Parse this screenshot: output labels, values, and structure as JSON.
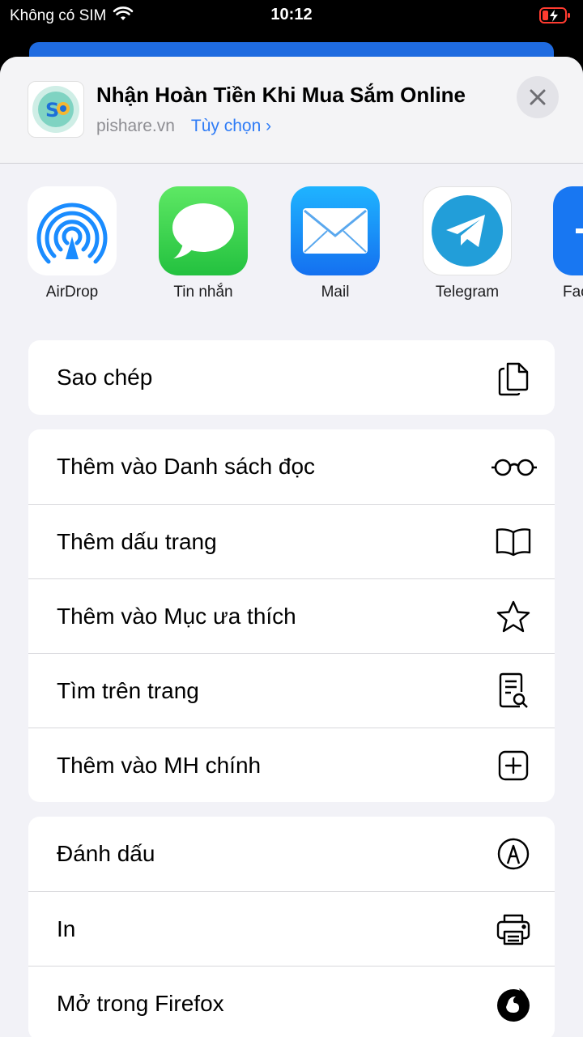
{
  "status": {
    "carrier": "Không có SIM",
    "time": "10:12"
  },
  "header": {
    "title": "Nhận Hoàn Tiền Khi Mua Sắm Online",
    "domain": "pishare.vn",
    "options_label": "Tùy chọn ›"
  },
  "apps": [
    {
      "label": "AirDrop",
      "icon": "airdrop-icon"
    },
    {
      "label": "Tin nhắn",
      "icon": "messages-icon"
    },
    {
      "label": "Mail",
      "icon": "mail-icon"
    },
    {
      "label": "Telegram",
      "icon": "telegram-icon"
    },
    {
      "label": "Fac",
      "icon": "facebook-icon"
    }
  ],
  "actions": {
    "group1": [
      {
        "label": "Sao chép",
        "icon": "copy-icon"
      }
    ],
    "group2": [
      {
        "label": "Thêm vào Danh sách đọc",
        "icon": "glasses-icon"
      },
      {
        "label": "Thêm dấu trang",
        "icon": "book-icon"
      },
      {
        "label": "Thêm vào Mục ưa thích",
        "icon": "star-icon"
      },
      {
        "label": "Tìm trên trang",
        "icon": "find-on-page-icon"
      },
      {
        "label": "Thêm vào MH chính",
        "icon": "add-square-icon"
      }
    ],
    "group3": [
      {
        "label": "Đánh dấu",
        "icon": "markup-icon"
      },
      {
        "label": "In",
        "icon": "printer-icon"
      },
      {
        "label": "Mở trong Firefox",
        "icon": "firefox-icon"
      }
    ]
  },
  "colors": {
    "accent": "#2f7cf6",
    "messages_green": "#34c759",
    "mail_blue": "#1a8cff",
    "telegram_blue": "#229ed9"
  }
}
